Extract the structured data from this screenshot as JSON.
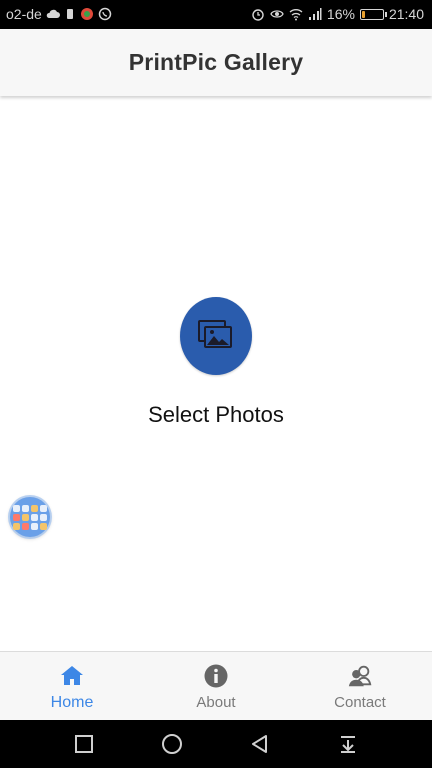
{
  "status_bar": {
    "carrier": "o2-de",
    "battery_percent": "16%",
    "battery_level": 0.16,
    "time": "21:40",
    "icons": [
      "cloud-icon",
      "battery-saver-icon",
      "app-icon",
      "whatsapp-icon",
      "alarm-icon",
      "eye-icon",
      "wifi-icon",
      "signal-icon",
      "battery-icon"
    ]
  },
  "app_bar": {
    "title": "PrintPic Gallery"
  },
  "main": {
    "select_button_icon": "photos-icon",
    "select_label": "Select Photos"
  },
  "floating_bubble": {
    "icon": "app-grid-icon"
  },
  "tabs": [
    {
      "label": "Home",
      "icon": "home-icon",
      "active": true
    },
    {
      "label": "About",
      "icon": "info-icon",
      "active": false
    },
    {
      "label": "Contact",
      "icon": "contact-icon",
      "active": false
    }
  ],
  "nav_bar": {
    "buttons": [
      "recents-icon",
      "home-circle-icon",
      "back-icon",
      "notifications-pull-icon"
    ]
  },
  "colors": {
    "accent": "#3d87e6",
    "select_button": "#2a5cad",
    "inactive_tab": "#7a7a7a",
    "app_bar_bg": "#f7f7f7"
  }
}
